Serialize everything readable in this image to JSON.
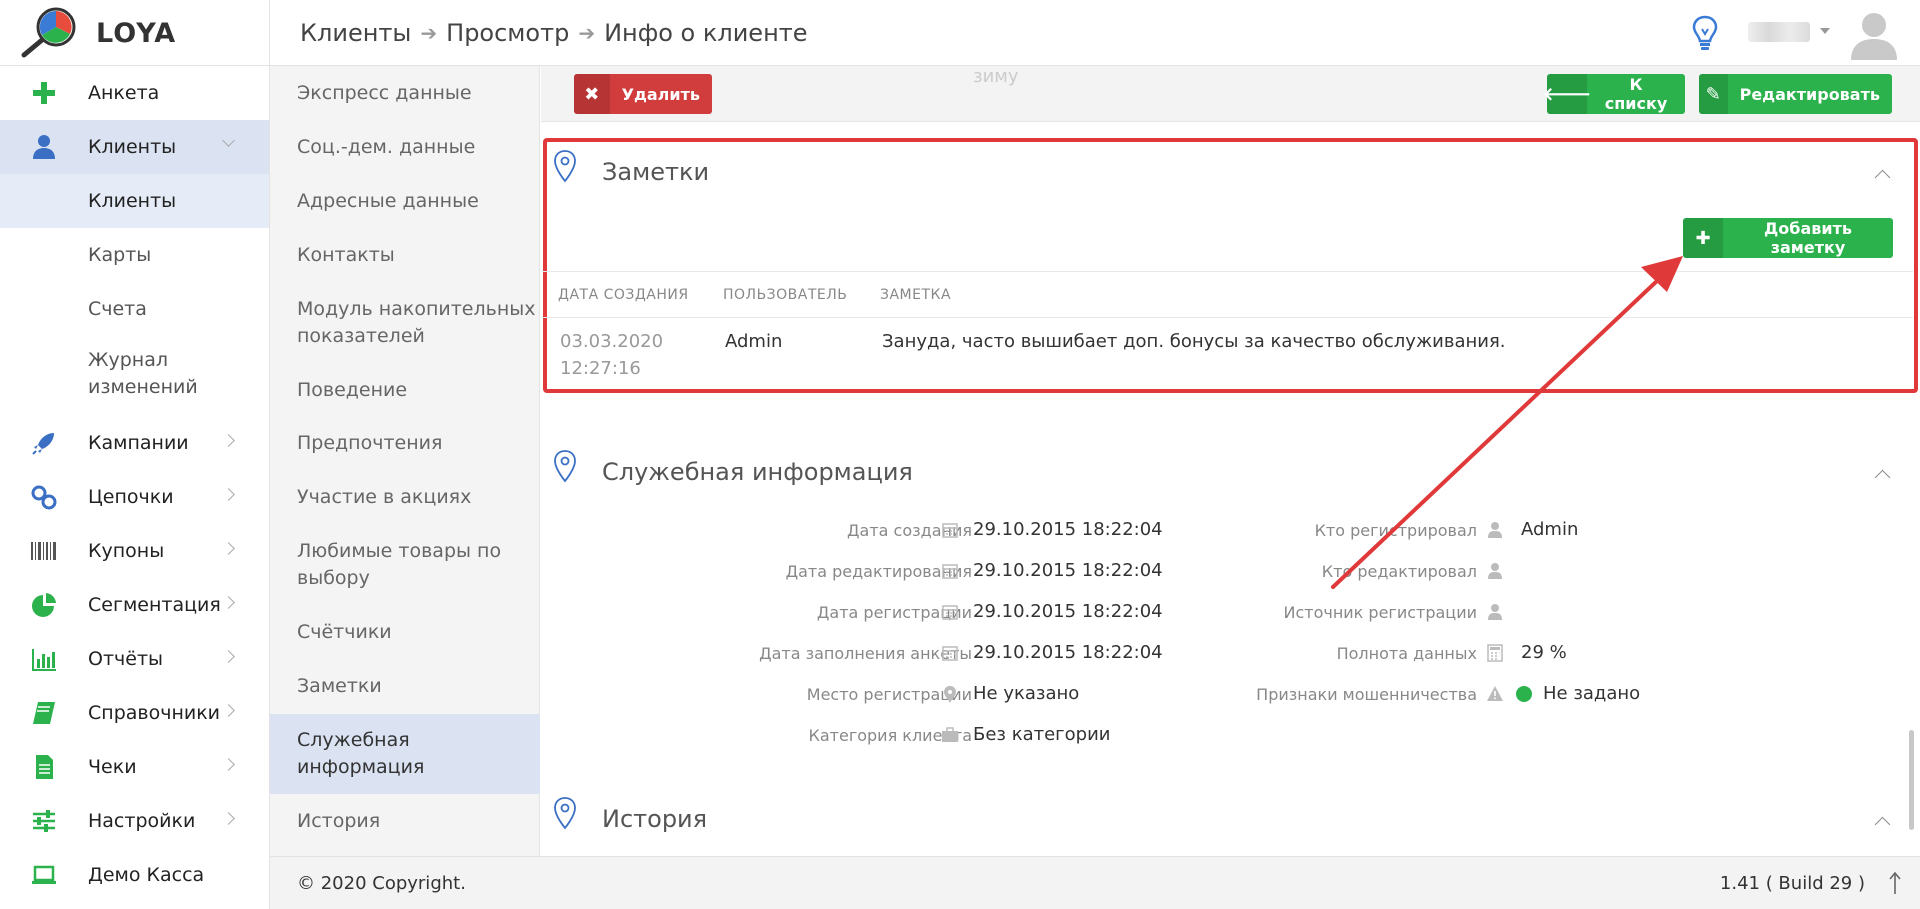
{
  "app": {
    "name": "LOYA"
  },
  "breadcrumb": {
    "items": [
      "Клиенты",
      "Просмотр",
      "Инфо о клиенте"
    ]
  },
  "sidebar": {
    "items": [
      {
        "label": "Анкета",
        "icon": "plus-icon"
      },
      {
        "label": "Клиенты",
        "icon": "user-icon",
        "active": true
      },
      {
        "label": "Кампании",
        "icon": "rocket-icon"
      },
      {
        "label": "Цепочки",
        "icon": "link-icon"
      },
      {
        "label": "Купоны",
        "icon": "barcode-icon"
      },
      {
        "label": "Сегментация",
        "icon": "pie-icon"
      },
      {
        "label": "Отчёты",
        "icon": "bar-chart-icon"
      },
      {
        "label": "Справочники",
        "icon": "book-icon"
      },
      {
        "label": "Чеки",
        "icon": "receipt-icon"
      },
      {
        "label": "Настройки",
        "icon": "sliders-icon"
      },
      {
        "label": "Демо Касса",
        "icon": "laptop-icon"
      }
    ],
    "sub_items": [
      "Клиенты",
      "Карты",
      "Счета",
      "Журнал изменений"
    ]
  },
  "section_nav": {
    "items": [
      "Экспресс данные",
      "Соц.-дем. данные",
      "Адресные данные",
      "Контакты",
      "Модуль накопительных показателей",
      "Поведение",
      "Предпочтения",
      "Участие в акциях",
      "Любимые товары по выбору",
      "Счётчики",
      "Заметки",
      "Служебная информация",
      "История"
    ]
  },
  "toolbar": {
    "delete_label": "Удалить",
    "back_label": "К списку",
    "edit_label": "Редактировать",
    "ghost_text": "зиму"
  },
  "notes": {
    "title": "Заметки",
    "add_label": "Добавить заметку",
    "columns": [
      "ДАТА СОЗДАНИЯ",
      "ПОЛЬЗОВАТЕЛЬ",
      "ЗАМЕТКА"
    ],
    "rows": [
      {
        "date": "03.03.2020",
        "time": "12:27:16",
        "user": "Admin",
        "note": "Зануда, часто вышибает доп. бонусы за качество обслуживания."
      }
    ]
  },
  "service_info": {
    "title": "Служебная информация",
    "left": [
      {
        "label": "Дата создания",
        "value": "29.10.2015 18:22:04"
      },
      {
        "label": "Дата редактирования",
        "value": "29.10.2015 18:22:04"
      },
      {
        "label": "Дата регистрации",
        "value": "29.10.2015 18:22:04"
      },
      {
        "label": "Дата заполнения анкеты",
        "value": "29.10.2015 18:22:04"
      },
      {
        "label": "Место регистрации",
        "value": "Не указано"
      },
      {
        "label": "Категория клиента",
        "value": "Без категории"
      }
    ],
    "right": [
      {
        "label": "Кто регистрировал",
        "value": "Admin"
      },
      {
        "label": "Кто редактировал",
        "value": ""
      },
      {
        "label": "Источник регистрации",
        "value": ""
      },
      {
        "label": "Полнота данных",
        "value": "29 %"
      },
      {
        "label": "Признаки мошенничества",
        "value": "Не задано"
      }
    ]
  },
  "history": {
    "title": "История"
  },
  "footer": {
    "copyright": "© 2020 Copyright.",
    "version": "1.41 ( Build 29 )"
  },
  "colors": {
    "accent_green": "#2bb24c",
    "danger_red": "#d13c3c",
    "annotation_red": "#e0393a",
    "active_bg": "#dbe3f3"
  }
}
